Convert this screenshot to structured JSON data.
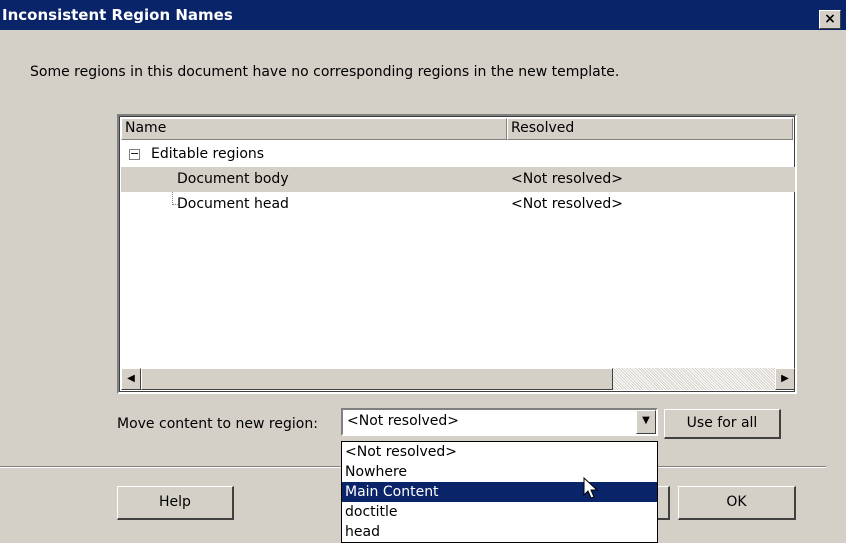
{
  "window": {
    "title": "Inconsistent Region Names",
    "close_label": "×"
  },
  "message": "Some regions in this document have no corresponding regions in the new template.",
  "tree": {
    "columns": [
      "Name",
      "Resolved"
    ],
    "group_label": "Editable regions",
    "expand_symbol": "−",
    "items": [
      {
        "name": "Document body",
        "resolved": "<Not resolved>"
      },
      {
        "name": "Document head",
        "resolved": "<Not resolved>"
      }
    ]
  },
  "scrollbar": {
    "left_arrow": "◀",
    "right_arrow": "▶"
  },
  "move": {
    "label": "Move content to new region:",
    "selected_value": "<Not resolved>",
    "arrow": "▼",
    "use_for_all_label": "Use for all"
  },
  "dropdown_options": [
    "<Not resolved>",
    "Nowhere",
    "Main Content",
    "doctitle",
    "head"
  ],
  "buttons": {
    "help": "Help",
    "ok": "OK"
  },
  "colors": {
    "title_bar": "#0a246a",
    "face": "#d4d0c8",
    "highlight": "#0a246a"
  }
}
